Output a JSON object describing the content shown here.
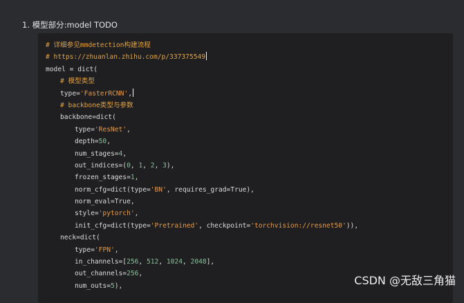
{
  "heading": "1. 模型部分:model TODO",
  "watermark": "CSDN @无敌三角猫",
  "code_lines": [
    {
      "indent": 0,
      "parts": [
        {
          "t": "comment",
          "v": "# 详细参见mmdetection构建流程"
        }
      ]
    },
    {
      "indent": 0,
      "parts": [
        {
          "t": "comment",
          "v": "# https://zhuanlan.zhihu.com/p/337375549"
        }
      ],
      "cursor": true
    },
    {
      "indent": 0,
      "parts": [
        {
          "t": "plain",
          "v": "model = dict("
        }
      ]
    },
    {
      "indent": 1,
      "parts": [
        {
          "t": "comment",
          "v": "# 模型类型"
        }
      ]
    },
    {
      "indent": 1,
      "parts": [
        {
          "t": "plain",
          "v": "type="
        },
        {
          "t": "str",
          "v": "'FasterRCNN'"
        },
        {
          "t": "plain",
          "v": ","
        }
      ],
      "cursor": true
    },
    {
      "indent": 1,
      "parts": [
        {
          "t": "comment",
          "v": "# backbone类型与参数"
        }
      ]
    },
    {
      "indent": 1,
      "parts": [
        {
          "t": "plain",
          "v": "backbone=dict("
        }
      ]
    },
    {
      "indent": 2,
      "parts": [
        {
          "t": "plain",
          "v": "type="
        },
        {
          "t": "str",
          "v": "'ResNet'"
        },
        {
          "t": "plain",
          "v": ","
        }
      ]
    },
    {
      "indent": 2,
      "parts": [
        {
          "t": "plain",
          "v": "depth="
        },
        {
          "t": "num",
          "v": "50"
        },
        {
          "t": "plain",
          "v": ","
        }
      ]
    },
    {
      "indent": 2,
      "parts": [
        {
          "t": "plain",
          "v": "num_stages="
        },
        {
          "t": "num",
          "v": "4"
        },
        {
          "t": "plain",
          "v": ","
        }
      ]
    },
    {
      "indent": 2,
      "parts": [
        {
          "t": "plain",
          "v": "out_indices=("
        },
        {
          "t": "num",
          "v": "0"
        },
        {
          "t": "plain",
          "v": ", "
        },
        {
          "t": "num",
          "v": "1"
        },
        {
          "t": "plain",
          "v": ", "
        },
        {
          "t": "num",
          "v": "2"
        },
        {
          "t": "plain",
          "v": ", "
        },
        {
          "t": "num",
          "v": "3"
        },
        {
          "t": "plain",
          "v": "),"
        }
      ]
    },
    {
      "indent": 2,
      "parts": [
        {
          "t": "plain",
          "v": "frozen_stages="
        },
        {
          "t": "num",
          "v": "1"
        },
        {
          "t": "plain",
          "v": ","
        }
      ]
    },
    {
      "indent": 2,
      "parts": [
        {
          "t": "plain",
          "v": "norm_cfg=dict(type="
        },
        {
          "t": "str",
          "v": "'BN'"
        },
        {
          "t": "plain",
          "v": ", requires_grad=True),"
        }
      ]
    },
    {
      "indent": 2,
      "parts": [
        {
          "t": "plain",
          "v": "norm_eval=True,"
        }
      ]
    },
    {
      "indent": 2,
      "parts": [
        {
          "t": "plain",
          "v": "style="
        },
        {
          "t": "str",
          "v": "'pytorch'"
        },
        {
          "t": "plain",
          "v": ","
        }
      ]
    },
    {
      "indent": 2,
      "parts": [
        {
          "t": "plain",
          "v": "init_cfg=dict(type="
        },
        {
          "t": "str",
          "v": "'Pretrained'"
        },
        {
          "t": "plain",
          "v": ", checkpoint="
        },
        {
          "t": "str",
          "v": "'torchvision://resnet50'"
        },
        {
          "t": "plain",
          "v": ")),"
        }
      ]
    },
    {
      "indent": 1,
      "parts": [
        {
          "t": "plain",
          "v": "neck=dict("
        }
      ]
    },
    {
      "indent": 2,
      "parts": [
        {
          "t": "plain",
          "v": "type="
        },
        {
          "t": "str",
          "v": "'FPN'"
        },
        {
          "t": "plain",
          "v": ","
        }
      ]
    },
    {
      "indent": 2,
      "parts": [
        {
          "t": "plain",
          "v": "in_channels=["
        },
        {
          "t": "num",
          "v": "256"
        },
        {
          "t": "plain",
          "v": ", "
        },
        {
          "t": "num",
          "v": "512"
        },
        {
          "t": "plain",
          "v": ", "
        },
        {
          "t": "num",
          "v": "1024"
        },
        {
          "t": "plain",
          "v": ", "
        },
        {
          "t": "num",
          "v": "2048"
        },
        {
          "t": "plain",
          "v": "],"
        }
      ]
    },
    {
      "indent": 2,
      "parts": [
        {
          "t": "plain",
          "v": "out_channels="
        },
        {
          "t": "num",
          "v": "256"
        },
        {
          "t": "plain",
          "v": ","
        }
      ]
    },
    {
      "indent": 2,
      "parts": [
        {
          "t": "plain",
          "v": "num_outs="
        },
        {
          "t": "num",
          "v": "5"
        },
        {
          "t": "plain",
          "v": "),"
        }
      ]
    }
  ]
}
